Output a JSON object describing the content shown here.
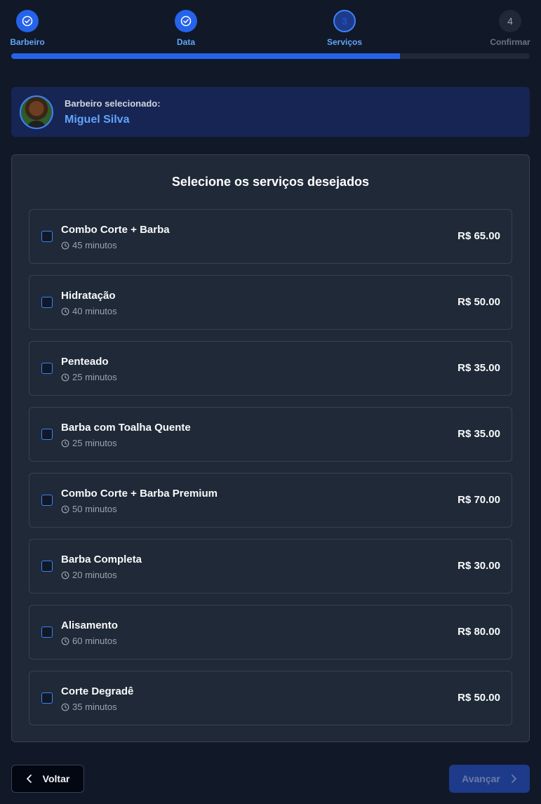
{
  "stepper": {
    "steps": [
      {
        "label": "Barbeiro",
        "number": "1",
        "state": "done"
      },
      {
        "label": "Data",
        "number": "2",
        "state": "done"
      },
      {
        "label": "Serviços",
        "number": "3",
        "state": "current"
      },
      {
        "label": "Confirmar",
        "number": "4",
        "state": "pending"
      }
    ],
    "progress_percent": 75
  },
  "barber": {
    "caption": "Barbeiro selecionado:",
    "name": "Miguel Silva"
  },
  "services_panel": {
    "title": "Selecione os serviços desejados",
    "items": [
      {
        "name": "Combo Corte + Barba",
        "duration": "45 minutos",
        "price": "R$ 65.00"
      },
      {
        "name": "Hidratação",
        "duration": "40 minutos",
        "price": "R$ 50.00"
      },
      {
        "name": "Penteado",
        "duration": "25 minutos",
        "price": "R$ 35.00"
      },
      {
        "name": "Barba com Toalha Quente",
        "duration": "25 minutos",
        "price": "R$ 35.00"
      },
      {
        "name": "Combo Corte + Barba Premium",
        "duration": "50 minutos",
        "price": "R$ 70.00"
      },
      {
        "name": "Barba Completa",
        "duration": "20 minutos",
        "price": "R$ 30.00"
      },
      {
        "name": "Alisamento",
        "duration": "60 minutos",
        "price": "R$ 80.00"
      },
      {
        "name": "Corte Degradê",
        "duration": "35 minutos",
        "price": "R$ 50.00"
      }
    ]
  },
  "footer": {
    "back_label": "Voltar",
    "next_label": "Avançar"
  },
  "colors": {
    "accent": "#2563eb",
    "accent_text": "#60a5fa",
    "background": "#111827",
    "panel": "#1f2937"
  }
}
